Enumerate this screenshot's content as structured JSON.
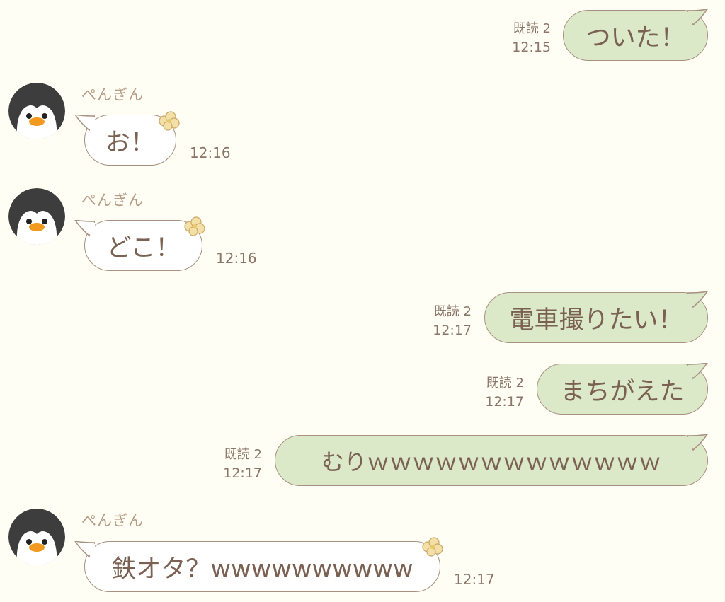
{
  "messages": [
    {
      "side": "me",
      "text": "ついた！",
      "read": "既読 2",
      "time": "12:15"
    },
    {
      "side": "them",
      "sender": "ぺんぎん",
      "text": "お！",
      "time": "12:16"
    },
    {
      "side": "them",
      "sender": "ぺんぎん",
      "text": "どこ！",
      "time": "12:16"
    },
    {
      "side": "me",
      "text": "電車撮りたい！",
      "read": "既読 2",
      "time": "12:17"
    },
    {
      "side": "me",
      "text": "まちがえた",
      "read": "既読 2",
      "time": "12:17"
    },
    {
      "side": "me",
      "text": "むりｗｗｗｗｗｗｗｗｗｗｗｗｗ",
      "read": "既読 2",
      "time": "12:17"
    },
    {
      "side": "them",
      "sender": "ぺんぎん",
      "text": "鉄オタ？wwwwwwwwww",
      "time": "12:17"
    }
  ],
  "icons": {
    "avatar": "penguin-avatar-icon",
    "decoration": "flower-icon"
  },
  "colors": {
    "background": "#fffef4",
    "my_bubble": "#dbe9c8",
    "their_bubble": "#ffffff",
    "text": "#7a6152",
    "sender": "#b59a84"
  }
}
